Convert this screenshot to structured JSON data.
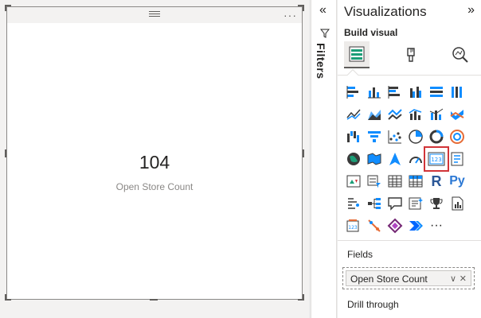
{
  "card": {
    "value": "104",
    "label": "Open Store Count"
  },
  "filters": {
    "label": "Filters"
  },
  "viz_pane": {
    "title": "Visualizations",
    "build_visual": "Build visual",
    "r_label": "R",
    "py_label": "Py",
    "more_label": "···",
    "fields_label": "Fields",
    "field_value": "Open Store Count",
    "drill_label": "Drill through"
  },
  "colors": {
    "accent_blue": "#118dff",
    "selection_red": "#d13438"
  }
}
